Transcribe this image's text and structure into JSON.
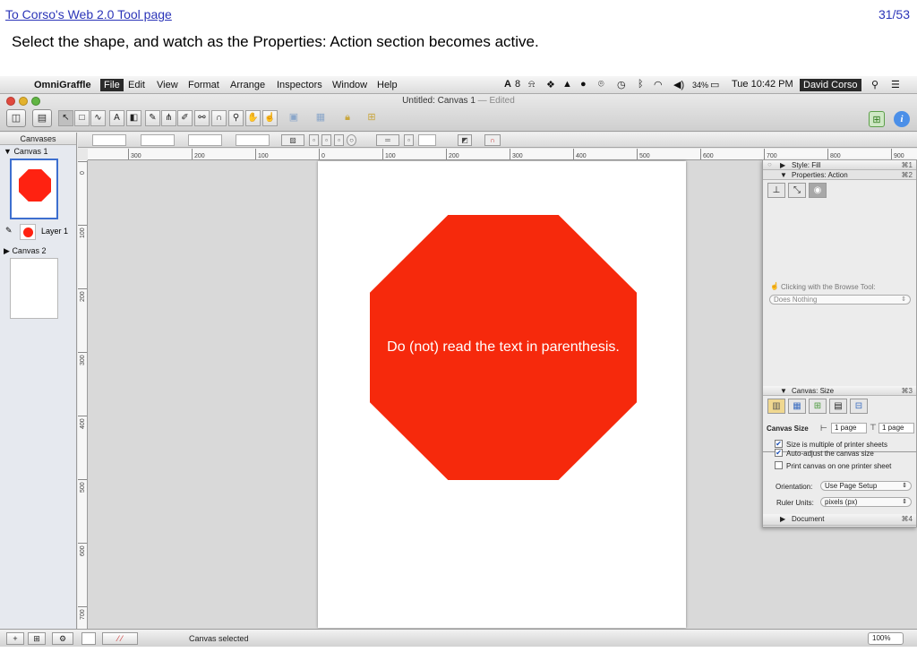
{
  "slide": {
    "link_text": "To Corso's Web 2.0 Tool page",
    "page_indicator": "31/53",
    "instruction": "Select the shape, and watch as the Properties: Action section becomes active."
  },
  "menubar": {
    "app_name": "OmniGraffle",
    "items": [
      "File",
      "Edit",
      "View",
      "Format",
      "Arrange",
      "Inspectors",
      "Window",
      "Help"
    ],
    "adobe": "8",
    "battery": "34%",
    "clock": "Tue 10:42 PM",
    "user": "David Corso"
  },
  "window": {
    "title": "Untitled: Canvas 1",
    "edited": "— Edited"
  },
  "sidebar": {
    "header": "Canvases",
    "canvas1": "Canvas 1",
    "layer1": "Layer 1",
    "canvas2": "Canvas 2"
  },
  "canvas": {
    "shape_text": "Do (not) read the text in parenthesis."
  },
  "ruler": {
    "h_ticks": [
      "300",
      "200",
      "100",
      "0",
      "100",
      "200",
      "300",
      "400",
      "500",
      "600",
      "700",
      "800",
      "900"
    ],
    "v_ticks": [
      "0",
      "100",
      "200",
      "300",
      "400",
      "500",
      "600",
      "700"
    ]
  },
  "inspector": {
    "style_fill": "Style: Fill",
    "style_fill_key": "⌘1",
    "properties_action": "Properties: Action",
    "properties_action_key": "⌘2",
    "browse_label": "Clicking with the Browse Tool:",
    "action_value": "Does Nothing",
    "canvas_size": "Canvas: Size",
    "canvas_size_key": "⌘3",
    "canvas_size_label": "Canvas Size",
    "width_value": "1 page",
    "height_value": "1 page",
    "check1": "Size is multiple of printer sheets",
    "check2": "Auto-adjust the canvas size",
    "check3": "Print canvas on one printer sheet",
    "orientation_label": "Orientation:",
    "orientation_value": "Use Page Setup",
    "ruler_units_label": "Ruler Units:",
    "ruler_units_value": "pixels (px)",
    "document": "Document",
    "document_key": "⌘4"
  },
  "statusbar": {
    "status": "Canvas selected",
    "zoom": "100%"
  },
  "colors": {
    "shape_fill": "#f6290c",
    "link": "#2b34b8",
    "selection": "#3d6fcf"
  }
}
